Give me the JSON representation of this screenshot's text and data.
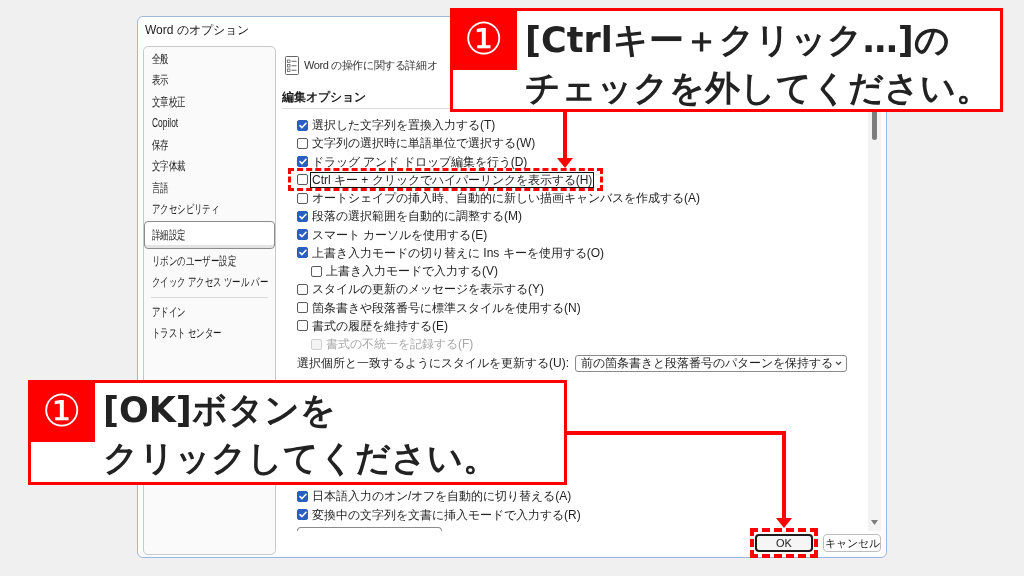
{
  "window": {
    "title": "Word のオプション"
  },
  "sidebar": {
    "groups": [
      [
        {
          "label": "全般",
          "selected": false
        },
        {
          "label": "表示",
          "selected": false
        },
        {
          "label": "文章校正",
          "selected": false
        },
        {
          "label": "Copilot",
          "selected": false
        },
        {
          "label": "保存",
          "selected": false
        },
        {
          "label": "文字体裁",
          "selected": false
        },
        {
          "label": "言語",
          "selected": false
        },
        {
          "label": "アクセシビリティ",
          "selected": false
        },
        {
          "label": "詳細設定",
          "selected": true
        },
        {
          "label": "リボンのユーザー設定",
          "selected": false
        },
        {
          "label": "クイック アクセス ツール バー",
          "selected": false
        }
      ],
      [
        {
          "label": "アドイン",
          "selected": false
        },
        {
          "label": "トラスト センター",
          "selected": false
        }
      ]
    ]
  },
  "header": {
    "text": "Word の操作に関する詳細オ"
  },
  "section": {
    "title": "編集オプション"
  },
  "option_groups": [
    [
      {
        "kind": "checkbox",
        "label": "選択した文字列を置換入力する(T)",
        "checked": true,
        "disabled": false,
        "focused": false,
        "highlighted": false
      },
      {
        "kind": "checkbox",
        "label": "文字列の選択時に単語単位で選択する(W)",
        "checked": false,
        "disabled": false,
        "focused": false,
        "highlighted": false
      },
      {
        "kind": "checkbox",
        "label": "ドラッグ アンド ドロップ編集を行う(D)",
        "checked": true,
        "disabled": false,
        "focused": false,
        "highlighted": false
      },
      {
        "kind": "checkbox",
        "label": "Ctrl キー + クリックでハイパーリンクを表示する(H)",
        "checked": false,
        "disabled": false,
        "focused": true,
        "highlighted": true
      },
      {
        "kind": "checkbox",
        "label": "オートシェイプの挿入時、自動的に新しい描画キャンバスを作成する(A)",
        "checked": false,
        "disabled": false,
        "focused": false,
        "highlighted": false
      },
      {
        "kind": "checkbox",
        "label": "段落の選択範囲を自動的に調整する(M)",
        "checked": true,
        "disabled": false,
        "focused": false,
        "highlighted": false
      },
      {
        "kind": "checkbox",
        "label": "スマート カーソルを使用する(E)",
        "checked": true,
        "disabled": false,
        "focused": false,
        "highlighted": false
      },
      {
        "kind": "checkbox",
        "label": "上書き入力モードの切り替えに Ins キーを使用する(O)",
        "checked": true,
        "disabled": false,
        "focused": false,
        "highlighted": false,
        "children": [
          {
            "kind": "checkbox",
            "label": "上書き入力モードで入力する(V)",
            "checked": false,
            "disabled": false,
            "focused": false,
            "highlighted": false
          }
        ]
      },
      {
        "kind": "checkbox",
        "label": "スタイルの更新のメッセージを表示する(Y)",
        "checked": false,
        "disabled": false,
        "focused": false,
        "highlighted": false
      },
      {
        "kind": "checkbox",
        "label": "箇条書きや段落番号に標準スタイルを使用する(N)",
        "checked": false,
        "disabled": false,
        "focused": false,
        "highlighted": false
      },
      {
        "kind": "checkbox",
        "label": "書式の履歴を維持する(E)",
        "checked": false,
        "disabled": false,
        "focused": false,
        "highlighted": false,
        "children": [
          {
            "kind": "checkbox",
            "label": "書式の不統一を記録する(F)",
            "checked": false,
            "disabled": true,
            "focused": false,
            "highlighted": false
          }
        ]
      },
      {
        "kind": "dropdown",
        "label": "選択個所と一致するようにスタイルを更新する(U):",
        "value": "前の箇条書きと段落番号のパターンを保持する"
      }
    ],
    [
      {
        "kind": "checkbox",
        "label": "日本語入力のオン/オフを自動的に切り替える(A)",
        "checked": true,
        "disabled": false,
        "focused": false,
        "highlighted": false
      },
      {
        "kind": "checkbox",
        "label": "変換中の文字列を文書に挿入モードで入力する(R)",
        "checked": true,
        "disabled": false,
        "focused": false,
        "highlighted": false
      },
      {
        "kind": "field"
      }
    ]
  ],
  "buttons": [
    {
      "label": "OK",
      "focused": true,
      "highlighted": true
    },
    {
      "label": "キャンセル",
      "focused": false,
      "highlighted": false
    }
  ],
  "callouts": [
    {
      "number": "①",
      "lines": [
        "[Ctrlキー＋クリック…]の",
        "チェックを外してください。"
      ]
    },
    {
      "number": "①",
      "lines": [
        "[OK]ボタンを",
        "クリックしてください。"
      ]
    }
  ]
}
